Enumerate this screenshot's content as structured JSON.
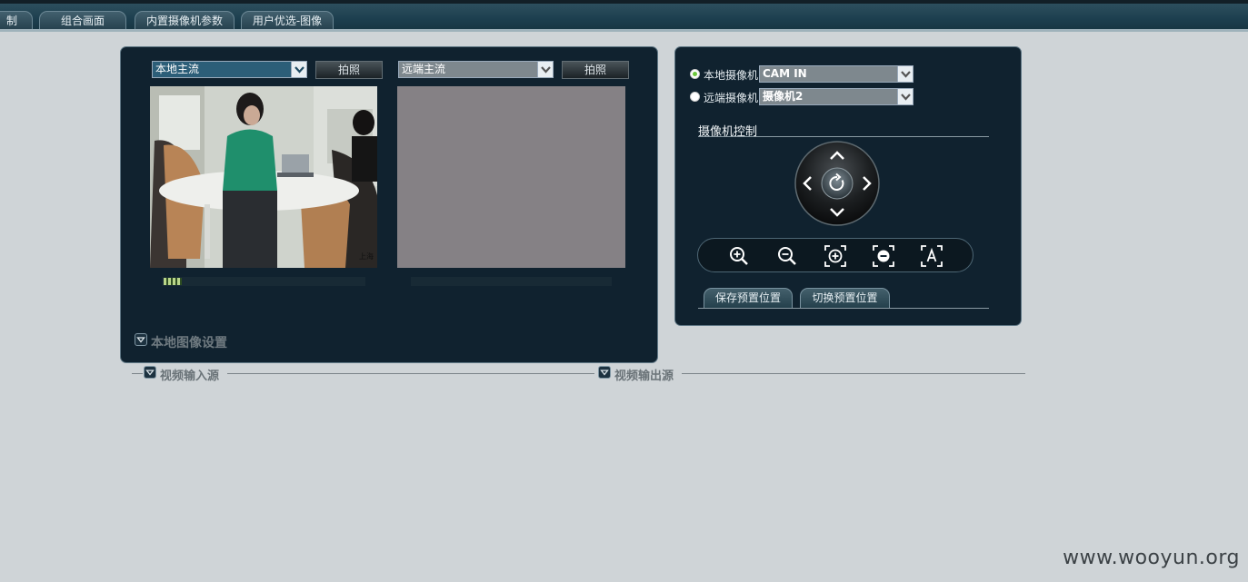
{
  "tabs": [
    "制",
    "组合画面",
    "内置摄像机参数",
    "用户优选-图像"
  ],
  "video_panel": {
    "local": {
      "stream_select": "本地主流",
      "snapshot_label": "拍照"
    },
    "remote": {
      "stream_select": "远端主流",
      "snapshot_label": "拍照"
    },
    "local_image_settings": "本地图像设置",
    "preview_scene_text": "上海"
  },
  "camera_panel": {
    "local_camera_label": "本地摄像机",
    "local_camera_value": "CAM IN",
    "remote_camera_label": "远端摄像机",
    "remote_camera_value": "摄像机2",
    "control_title": "摄像机控制",
    "save_preset_label": "保存预置位置",
    "switch_preset_label": "切换预置位置"
  },
  "sections": {
    "video_input": "视频输入源",
    "video_output": "视频输出源"
  },
  "watermark": "www.wooyun.org",
  "colors": {
    "topbar": "#1d3f4f",
    "panel": "#10222f",
    "local_select": "#2c5e78",
    "remote_select": "#7e888e",
    "remote_video": "#858185",
    "page_bg": "#cfd4d7",
    "radio_active": "#6cc83c"
  },
  "icons": {
    "ptz": [
      "arrow-up-icon",
      "arrow-down-icon",
      "arrow-left-icon",
      "arrow-right-icon",
      "reset-icon"
    ],
    "zoom": [
      "zoom-in-icon",
      "zoom-out-icon",
      "focus-in-icon",
      "focus-out-icon",
      "auto-focus-icon"
    ]
  }
}
